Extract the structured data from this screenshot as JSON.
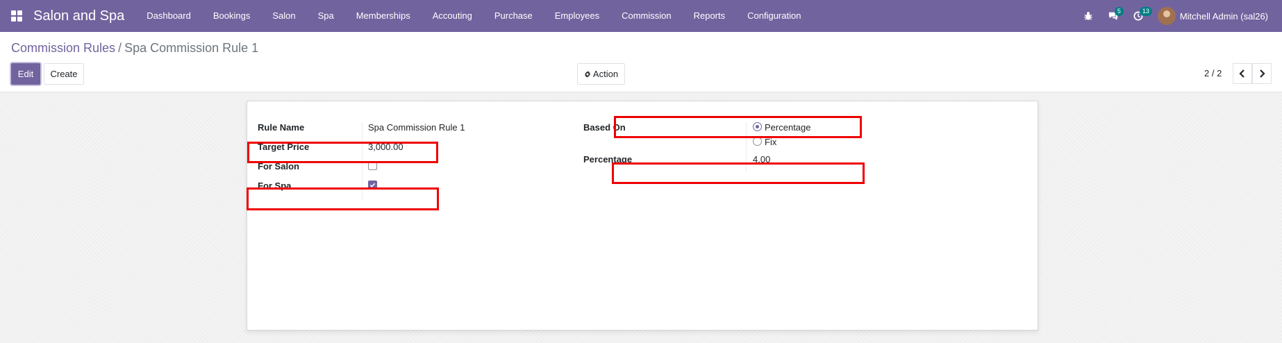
{
  "navbar": {
    "brand": "Salon and Spa",
    "menu": [
      "Dashboard",
      "Bookings",
      "Salon",
      "Spa",
      "Memberships",
      "Accouting",
      "Purchase",
      "Employees",
      "Commission",
      "Reports",
      "Configuration"
    ],
    "messages_count": "5",
    "activities_count": "13",
    "user_name": "Mitchell Admin (sal26)"
  },
  "breadcrumb": {
    "parent": "Commission Rules",
    "separator": "/",
    "current": "Spa Commission Rule 1"
  },
  "buttons": {
    "edit": "Edit",
    "create": "Create",
    "action": "Action"
  },
  "pager": {
    "value": "2 / 2"
  },
  "form": {
    "rule_name_label": "Rule Name",
    "rule_name_value": "Spa Commission Rule 1",
    "target_price_label": "Target Price",
    "target_price_value": "3,000.00",
    "for_salon_label": "For Salon",
    "for_salon_checked": false,
    "for_spa_label": "For Spa",
    "for_spa_checked": true,
    "based_on_label": "Based On",
    "based_on_options": [
      "Percentage",
      "Fix"
    ],
    "based_on_selected": "Percentage",
    "percentage_label": "Percentage",
    "percentage_value": "4.00"
  },
  "colors": {
    "navbar": "#71639e",
    "accent": "#71639e",
    "highlight": "#ee0000",
    "badge": "#017e84"
  }
}
